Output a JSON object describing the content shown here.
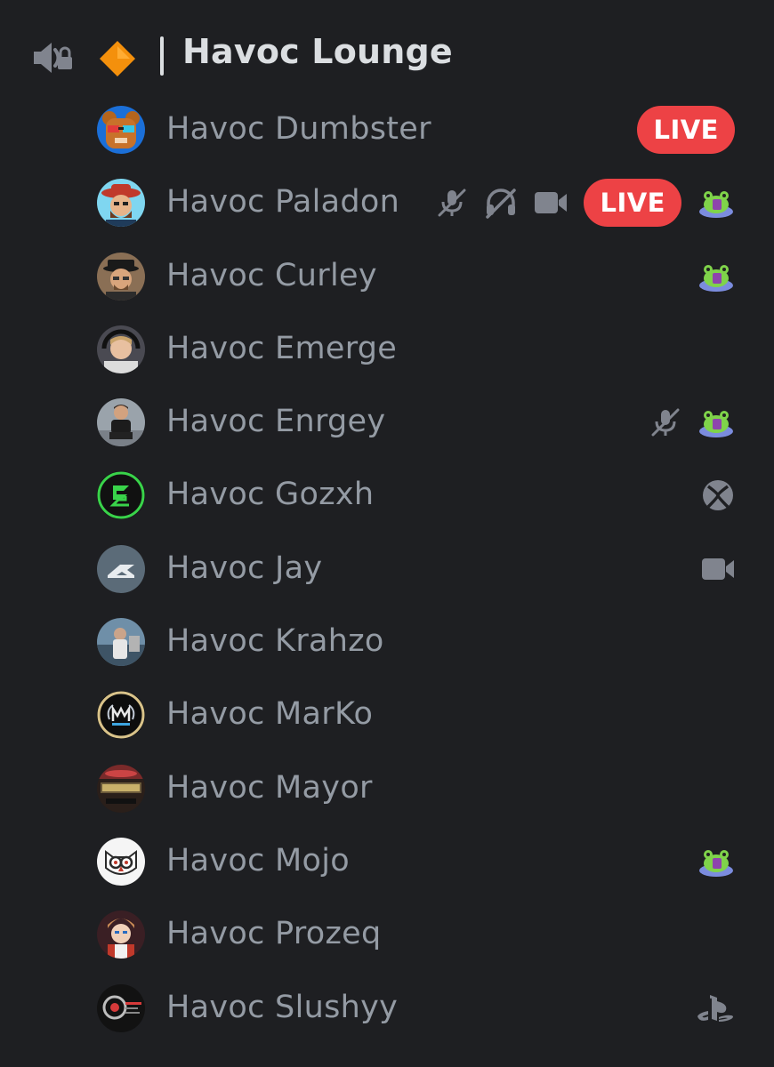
{
  "channel": {
    "name": "Havoc Lounge",
    "icon": "speaker-lock-icon",
    "emoji": "orange-diamond-icon"
  },
  "colors": {
    "background": "#1e1f22",
    "text_muted": "#949ba4",
    "text_bright": "#dbdee1",
    "live": "#ed4245",
    "nitro_frog": "#7fd34a"
  },
  "users": [
    {
      "name": "Havoc Dumbster",
      "live": "LIVE",
      "icons": []
    },
    {
      "name": "Havoc Paladon",
      "live": "LIVE",
      "icons": [
        "mic-muted-icon",
        "headset-deafened-icon",
        "video-camera-icon",
        "live-badge",
        "frog-activity-icon"
      ]
    },
    {
      "name": "Havoc Curley",
      "icons": [
        "frog-activity-icon"
      ]
    },
    {
      "name": "Havoc Emerge",
      "icons": []
    },
    {
      "name": "Havoc Enrgey",
      "icons": [
        "mic-muted-icon",
        "frog-activity-icon"
      ]
    },
    {
      "name": "Havoc Gozxh",
      "icons": [
        "xbox-icon"
      ]
    },
    {
      "name": "Havoc Jay",
      "icons": [
        "video-camera-icon"
      ]
    },
    {
      "name": "Havoc Krahzo",
      "icons": []
    },
    {
      "name": "Havoc MarKo",
      "icons": []
    },
    {
      "name": "Havoc Mayor",
      "icons": []
    },
    {
      "name": "Havoc Mojo",
      "icons": [
        "frog-activity-icon"
      ]
    },
    {
      "name": "Havoc Prozeq",
      "icons": []
    },
    {
      "name": "Havoc Slushyy",
      "icons": [
        "playstation-icon"
      ]
    }
  ]
}
